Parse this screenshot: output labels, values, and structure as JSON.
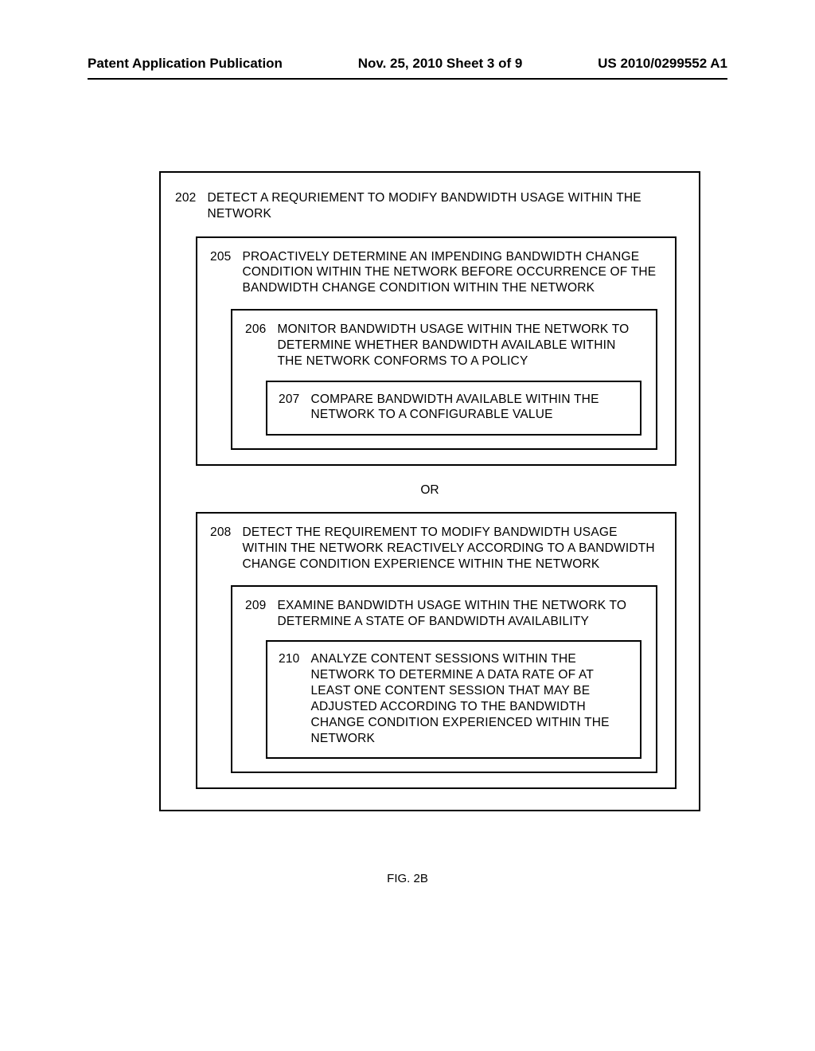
{
  "header": {
    "left": "Patent Application Publication",
    "center": "Nov. 25, 2010  Sheet 3 of 9",
    "right": "US 2010/0299552 A1"
  },
  "figure": {
    "caption": "FIG. 2B",
    "step202": {
      "num": "202",
      "text": "DETECT A REQURIEMENT TO MODIFY BANDWIDTH USAGE WITHIN THE NETWORK"
    },
    "step205": {
      "num": "205",
      "text": "PROACTIVELY DETERMINE AN IMPENDING BANDWIDTH CHANGE CONDITION WITHIN THE NETWORK BEFORE OCCURRENCE OF THE BANDWIDTH CHANGE CONDITION WITHIN THE NETWORK"
    },
    "step206": {
      "num": "206",
      "text": "MONITOR BANDWIDTH USAGE WITHIN THE NETWORK TO DETERMINE WHETHER BANDWIDTH AVAILABLE WITHIN THE NETWORK CONFORMS TO A POLICY"
    },
    "step207": {
      "num": "207",
      "text": "COMPARE BANDWIDTH AVAILABLE WITHIN THE NETWORK TO A CONFIGURABLE VALUE"
    },
    "or_label": "OR",
    "step208": {
      "num": "208",
      "text": "DETECT THE REQUIREMENT TO MODIFY BANDWIDTH USAGE WITHIN THE NETWORK REACTIVELY ACCORDING TO A BANDWIDTH CHANGE CONDITION EXPERIENCE WITHIN THE NETWORK"
    },
    "step209": {
      "num": "209",
      "text": "EXAMINE BANDWIDTH USAGE WITHIN THE NETWORK TO DETERMINE A STATE OF BANDWIDTH AVAILABILITY"
    },
    "step210": {
      "num": "210",
      "text": "ANALYZE CONTENT SESSIONS WITHIN THE NETWORK TO DETERMINE A DATA RATE OF AT LEAST ONE CONTENT SESSION THAT MAY BE ADJUSTED ACCORDING TO THE BANDWIDTH CHANGE CONDITION EXPERIENCED WITHIN THE NETWORK"
    }
  }
}
